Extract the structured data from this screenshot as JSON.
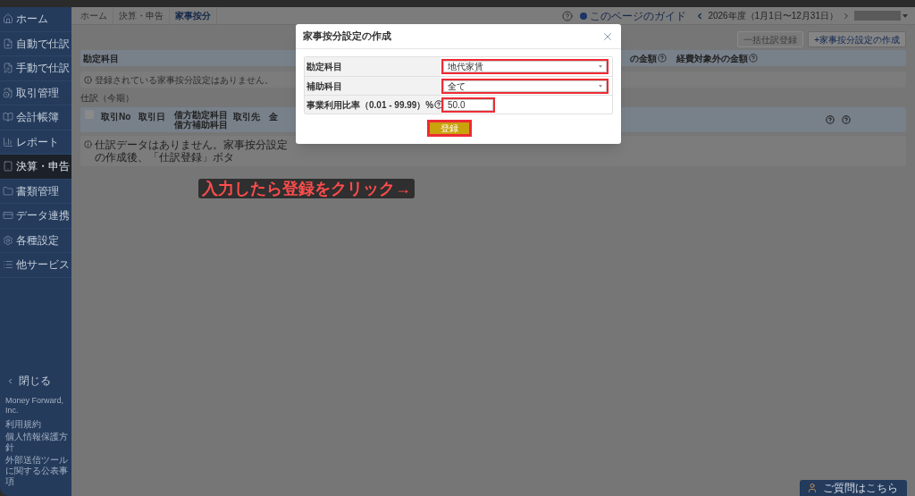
{
  "sidebar": {
    "items": [
      {
        "label": "ホーム",
        "selected": false
      },
      {
        "label": "自動で仕訳",
        "selected": false
      },
      {
        "label": "手動で仕訳",
        "selected": false
      },
      {
        "label": "取引管理",
        "selected": false
      },
      {
        "label": "会計帳簿",
        "selected": false
      },
      {
        "label": "レポート",
        "selected": false
      },
      {
        "label": "決算・申告",
        "selected": true
      },
      {
        "label": "書類管理",
        "selected": false
      },
      {
        "label": "データ連携",
        "selected": false
      },
      {
        "label": "各種設定",
        "selected": false
      },
      {
        "label": "他サービス",
        "selected": false
      }
    ],
    "close": "閉じる",
    "company": "Money Forward, Inc.",
    "links": [
      "利用規約",
      "個人情報保護方針",
      "外部送信ツールに関する公表事項"
    ]
  },
  "breadcrumbs": [
    {
      "label": "ホーム",
      "selected": false
    },
    {
      "label": "決算・申告",
      "selected": false
    },
    {
      "label": "家事按分",
      "selected": true
    }
  ],
  "header": {
    "guide": "このページのガイド",
    "period": "2026年度（1月1日〜12月31日）"
  },
  "actions": [
    {
      "label": "一括仕訳登録",
      "disabled": true
    },
    {
      "label": "+家事按分設定の作成",
      "disabled": false
    }
  ],
  "settings_table": {
    "columns": [
      "勘定科目",
      "の金額",
      "経費対象外の金額"
    ],
    "empty_message": "登録されている家事按分設定はありません。"
  },
  "journal": {
    "title": "仕訳（今期）",
    "select_all_checked": false,
    "columns": [
      "取引No",
      "取引日",
      "借方勘定科目",
      "借方補助科目",
      "取引先",
      "金"
    ],
    "empty_message": "仕訳データはありません。家事按分設定の作成後、「仕訳登録」ボタ"
  },
  "modal": {
    "title": "家事按分設定の作成",
    "fields": [
      {
        "label": "勘定科目",
        "kind": "select",
        "value": "地代家賃",
        "highlighted": true,
        "help": false
      },
      {
        "label": "補助科目",
        "kind": "select",
        "value": "全て",
        "highlighted": true,
        "help": false
      },
      {
        "label": "事業利用比率（0.01 - 99.99）%",
        "kind": "text",
        "value": "50.0",
        "highlighted": true,
        "help": true
      }
    ],
    "submit": {
      "label": "登録",
      "highlighted": true
    }
  },
  "annotation": "入力したら登録をクリック→",
  "help_button": "ご質問はこちら"
}
